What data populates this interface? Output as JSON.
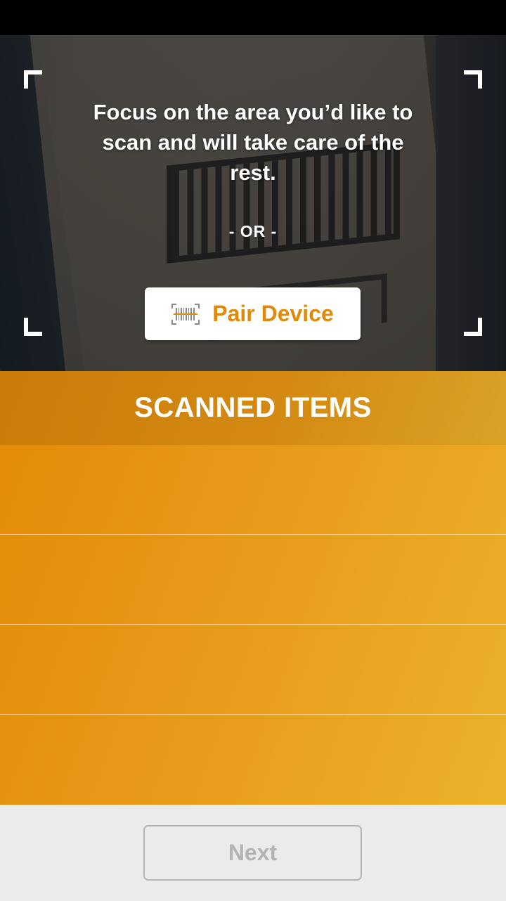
{
  "scanner": {
    "instruction": "Focus on the area you’d like to scan and will take care of the rest.",
    "or_text": "- OR -",
    "pair_button": {
      "label": "Pair Device",
      "icon": "barcode-scanner-icon"
    }
  },
  "scanned_items": {
    "header": "SCANNED ITEMS",
    "rows": [
      "",
      "",
      "",
      ""
    ]
  },
  "footer": {
    "next_label": "Next",
    "next_enabled": false
  },
  "colors": {
    "accent": "#e08a0c",
    "header_bg": "#cf8410",
    "list_bg_start": "#e38a08",
    "list_bg_end": "#ecb22a",
    "footer_bg": "#ebebeb",
    "disabled_text": "#b3b3b3"
  }
}
